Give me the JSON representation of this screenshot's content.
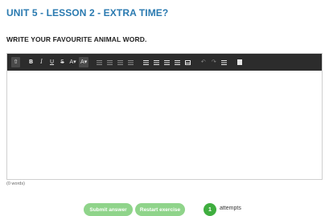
{
  "exercise": {
    "title": "UNIT 5 - LESSON 2 - EXTRA TIME?",
    "prompt": "WRITE YOUR FAVOURITE ANIMAL WORD."
  },
  "toolbar": {
    "upload_glyph": "⇧",
    "bold": "B",
    "italic": "I",
    "underline": "U",
    "strike": "S",
    "font_color": "A▾",
    "bg_color": "A▾",
    "undo_glyph": "↶",
    "redo_glyph": "↷",
    "icons": [
      "upload-icon",
      "bold-icon",
      "italic-icon",
      "underline-icon",
      "strikethrough-icon",
      "font-color-icon",
      "background-color-icon",
      "bullet-list-icon",
      "numbered-list-icon",
      "outdent-icon",
      "indent-icon",
      "align-left-icon",
      "align-center-icon",
      "align-right-icon",
      "align-justify-icon",
      "table-icon",
      "undo-icon",
      "redo-icon",
      "horizontal-rule-icon",
      "source-icon"
    ]
  },
  "editor": {
    "value": "",
    "word_count": "(0 words)"
  },
  "actions": {
    "submit_label": "Submit answer",
    "restart_label": "Restart exercise"
  },
  "attempts": {
    "count": "1",
    "label": "attempts"
  },
  "colors": {
    "title": "#2a7ab0",
    "toolbar_bg": "#2c2c2c",
    "button_green": "#8fd48a",
    "badge_green": "#3fae3f"
  }
}
